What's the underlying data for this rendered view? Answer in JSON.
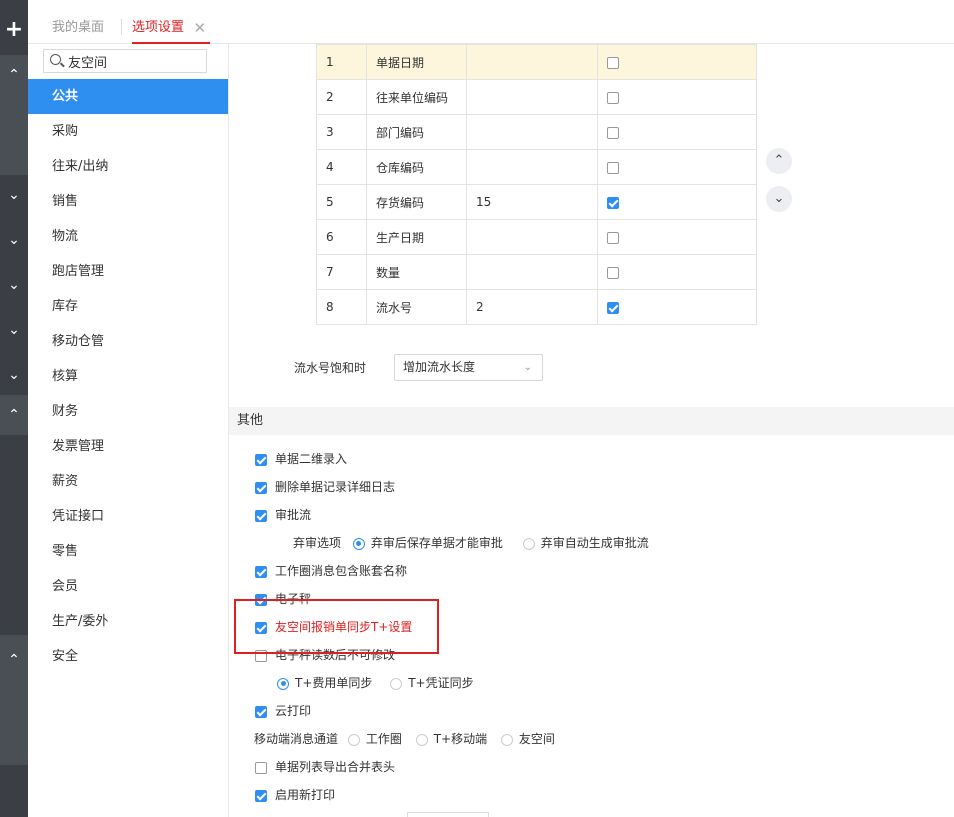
{
  "tabs": {
    "desktop": "我的桌面",
    "options": "选项设置"
  },
  "search": {
    "value": "友空间"
  },
  "menu": [
    "公共",
    "采购",
    "往来/出纳",
    "销售",
    "物流",
    "跑店管理",
    "库存",
    "移动仓管",
    "核算",
    "财务",
    "发票管理",
    "薪资",
    "凭证接口",
    "零售",
    "会员",
    "生产/委外",
    "安全"
  ],
  "menu_active_index": 0,
  "grid": {
    "rows": [
      {
        "no": "1",
        "name": "单据日期",
        "len": "",
        "checked": false
      },
      {
        "no": "2",
        "name": "往来单位编码",
        "len": "",
        "checked": false
      },
      {
        "no": "3",
        "name": "部门编码",
        "len": "",
        "checked": false
      },
      {
        "no": "4",
        "name": "仓库编码",
        "len": "",
        "checked": false
      },
      {
        "no": "5",
        "name": "存货编码",
        "len": "15",
        "checked": true
      },
      {
        "no": "6",
        "name": "生产日期",
        "len": "",
        "checked": false
      },
      {
        "no": "7",
        "name": "数量",
        "len": "",
        "checked": false
      },
      {
        "no": "8",
        "name": "流水号",
        "len": "2",
        "checked": true
      }
    ]
  },
  "serial": {
    "label": "流水号饱和时",
    "value": "增加流水长度"
  },
  "other": {
    "title": "其他",
    "o1": "单据二维录入",
    "o2": "删除单据记录详细日志",
    "o3": "审批流",
    "abandon_label": "弃审选项",
    "abandon_opt1": "弃审后保存单据才能审批",
    "abandon_opt2": "弃审自动生成审批流",
    "o4": "工作圈消息包含账套名称",
    "o5": "电子秤",
    "o6": "友空间报销单同步T+设置",
    "o7": "电子秤读数后不可修改",
    "sync_opt1": "T+费用单同步",
    "sync_opt2": "T+凭证同步",
    "o8": "云打印",
    "mobile_label": "移动端消息通道",
    "mobile_opt1": "工作圈",
    "mobile_opt2": "T+移动端",
    "mobile_opt3": "友空间",
    "o9": "单据列表导出合并表头",
    "o10": "启用新打印"
  },
  "colors": {
    "accent": "#2f8ff0",
    "highlight": "#e02020",
    "rail": "#3b3f45"
  }
}
